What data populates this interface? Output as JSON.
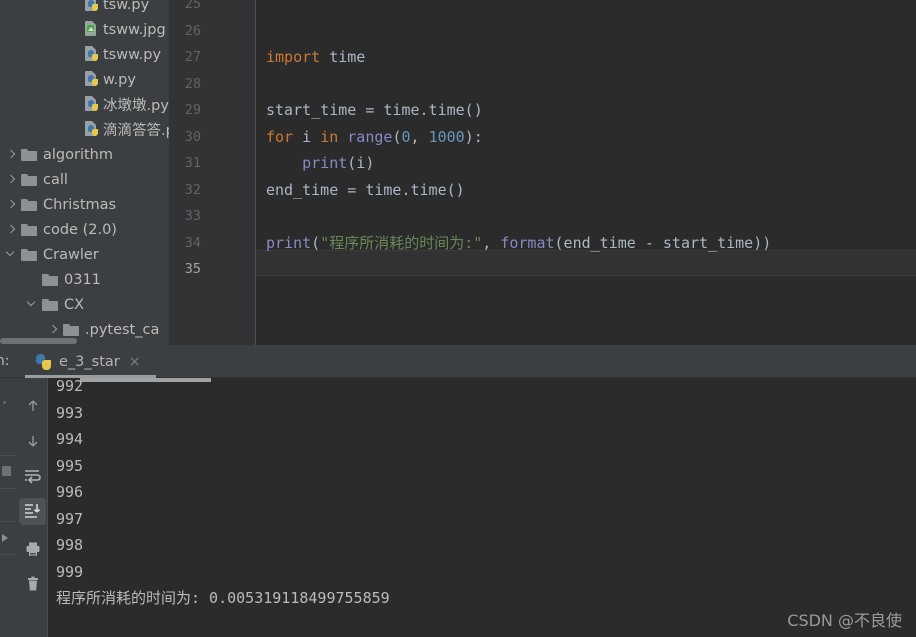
{
  "project_tree": {
    "name": "project-file-tree",
    "items": [
      {
        "label": "tsw.py",
        "type": "py",
        "depth": 3,
        "arrow": "none",
        "partial_top": true
      },
      {
        "label": "tsww.jpg",
        "type": "img",
        "depth": 3,
        "arrow": "none"
      },
      {
        "label": "tsww.py",
        "type": "py",
        "depth": 3,
        "arrow": "none"
      },
      {
        "label": "w.py",
        "type": "py",
        "depth": 3,
        "arrow": "none"
      },
      {
        "label": "冰墩墩.py",
        "type": "py",
        "depth": 3,
        "arrow": "none"
      },
      {
        "label": "滴滴答答.py",
        "type": "py",
        "depth": 3,
        "arrow": "none"
      },
      {
        "label": "algorithm",
        "type": "folder",
        "depth": 0,
        "arrow": "right"
      },
      {
        "label": "call",
        "type": "folder",
        "depth": 0,
        "arrow": "right"
      },
      {
        "label": "Christmas",
        "type": "folder",
        "depth": 0,
        "arrow": "right"
      },
      {
        "label": "code  (2.0)",
        "type": "folder",
        "depth": 0,
        "arrow": "right"
      },
      {
        "label": "Crawler",
        "type": "folder",
        "depth": 0,
        "arrow": "down"
      },
      {
        "label": "0311",
        "type": "folder",
        "depth": 1,
        "arrow": "none"
      },
      {
        "label": "CX",
        "type": "folder",
        "depth": 1,
        "arrow": "down"
      },
      {
        "label": ".pytest_ca",
        "type": "folder",
        "depth": 2,
        "arrow": "right"
      }
    ]
  },
  "editor": {
    "name": "code-editor",
    "line_numbers": [
      "25",
      "26",
      "27",
      "28",
      "29",
      "30",
      "31",
      "32",
      "33",
      "34",
      "35"
    ],
    "current_line": "35",
    "lines": [
      {
        "number": "25",
        "tokens": []
      },
      {
        "number": "26",
        "tokens": []
      },
      {
        "number": "27",
        "tokens": [
          {
            "t": "import",
            "c": "kw"
          },
          {
            "t": " time",
            "c": "id"
          }
        ]
      },
      {
        "number": "28",
        "tokens": []
      },
      {
        "number": "29",
        "tokens": [
          {
            "t": "start_time = time.time()",
            "c": "id"
          }
        ]
      },
      {
        "number": "30",
        "tokens": [
          {
            "t": "for",
            "c": "kw"
          },
          {
            "t": " i ",
            "c": "id"
          },
          {
            "t": "in",
            "c": "kw"
          },
          {
            "t": " ",
            "c": "id"
          },
          {
            "t": "range",
            "c": "fn"
          },
          {
            "t": "(",
            "c": "id"
          },
          {
            "t": "0",
            "c": "num"
          },
          {
            "t": ", ",
            "c": "id"
          },
          {
            "t": "1000",
            "c": "num"
          },
          {
            "t": "):",
            "c": "id"
          }
        ]
      },
      {
        "number": "31",
        "tokens": [
          {
            "t": "    ",
            "c": "id"
          },
          {
            "t": "print",
            "c": "fn"
          },
          {
            "t": "(i)",
            "c": "id"
          }
        ]
      },
      {
        "number": "32",
        "tokens": [
          {
            "t": "end_time = time.time()",
            "c": "id"
          }
        ]
      },
      {
        "number": "33",
        "tokens": []
      },
      {
        "number": "34",
        "tokens": [
          {
            "t": "print",
            "c": "fn"
          },
          {
            "t": "(",
            "c": "id"
          },
          {
            "t": "\"程序所消耗的时间为:\"",
            "c": "str"
          },
          {
            "t": ", ",
            "c": "id"
          },
          {
            "t": "format",
            "c": "fn"
          },
          {
            "t": "(end_time - start_time))",
            "c": "id"
          }
        ]
      },
      {
        "number": "35",
        "tokens": []
      }
    ],
    "colors": {
      "background": "#2b2b2b",
      "gutter": "#313335",
      "default_text": "#a9b7c6",
      "keyword": "#cc7832",
      "function": "#8888c6",
      "number": "#6897bb",
      "string": "#6a8759",
      "line_number": "#606366",
      "current_line_number": "#a4a3a3"
    }
  },
  "run_panel": {
    "name": "run-tool-window",
    "label": "un:",
    "full_label": "Run:",
    "tab": {
      "label": "e_3_star",
      "icon": "python-file-icon",
      "close": "×"
    },
    "toolbar": [
      {
        "name": "up-arrow-icon",
        "title": "Up the stack trace",
        "active": false
      },
      {
        "name": "down-arrow-icon",
        "title": "Down the stack trace",
        "active": false
      },
      {
        "name": "soft-wrap-icon",
        "title": "Soft-Wrap",
        "active": false
      },
      {
        "name": "scroll-to-end-icon",
        "title": "Scroll to the end",
        "active": true
      },
      {
        "name": "print-icon",
        "title": "Print",
        "active": false
      },
      {
        "name": "trash-icon",
        "title": "Clear All",
        "active": false
      }
    ],
    "console_output": [
      "992",
      "993",
      "994",
      "995",
      "996",
      "997",
      "998",
      "999",
      "程序所消耗的时间为: 0.005319118499755859"
    ],
    "colors": {
      "panel_background": "#3c3f41",
      "console_background": "#2b2b2b",
      "output_text": "#bbbbbb"
    }
  },
  "watermark": {
    "name": "csdn-watermark",
    "text": "CSDN @不良使"
  }
}
